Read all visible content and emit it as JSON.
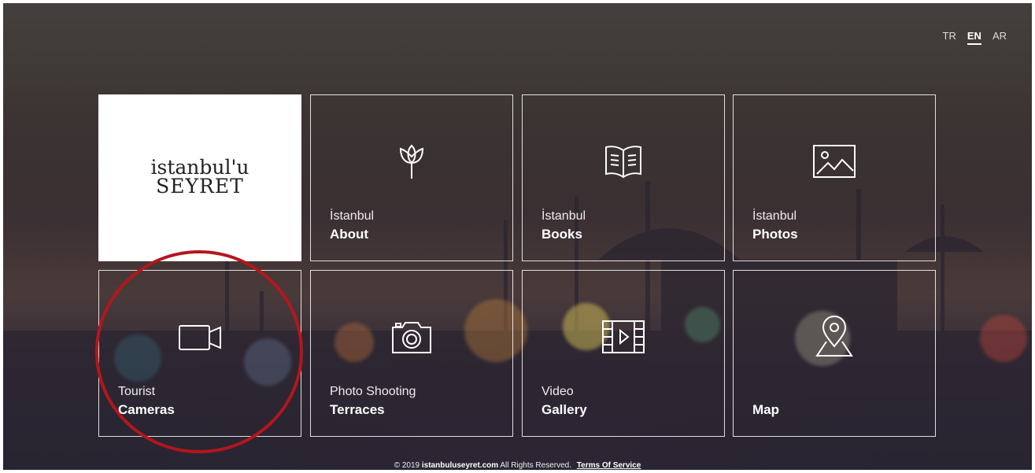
{
  "languages": [
    {
      "code": "TR",
      "active": false
    },
    {
      "code": "EN",
      "active": true
    },
    {
      "code": "AR",
      "active": false
    }
  ],
  "logo": {
    "line1": "istanbul'u",
    "line2": "SEYRET"
  },
  "tiles": [
    {
      "id": "about",
      "line1": "İstanbul",
      "line2": "About",
      "icon": "tulip-icon"
    },
    {
      "id": "books",
      "line1": "İstanbul",
      "line2": "Books",
      "icon": "book-icon"
    },
    {
      "id": "photos",
      "line1": "İstanbul",
      "line2": "Photos",
      "icon": "picture-icon"
    },
    {
      "id": "cameras",
      "line1": "Tourist",
      "line2": "Cameras",
      "icon": "video-camera-icon"
    },
    {
      "id": "terraces",
      "line1": "Photo Shooting",
      "line2": "Terraces",
      "icon": "camera-icon"
    },
    {
      "id": "gallery",
      "line1": "Video",
      "line2": "Gallery",
      "icon": "film-icon"
    },
    {
      "id": "map",
      "line1": "",
      "line2": "Map",
      "icon": "map-pin-icon"
    }
  ],
  "footer": {
    "prefix": "© 2019",
    "site": "istanbuluseyret.com",
    "rights": "All Rights Reserved.",
    "terms": "Terms Of Service"
  },
  "colors": {
    "highlight_circle": "#b3161c",
    "tile_border": "#ffffff"
  }
}
